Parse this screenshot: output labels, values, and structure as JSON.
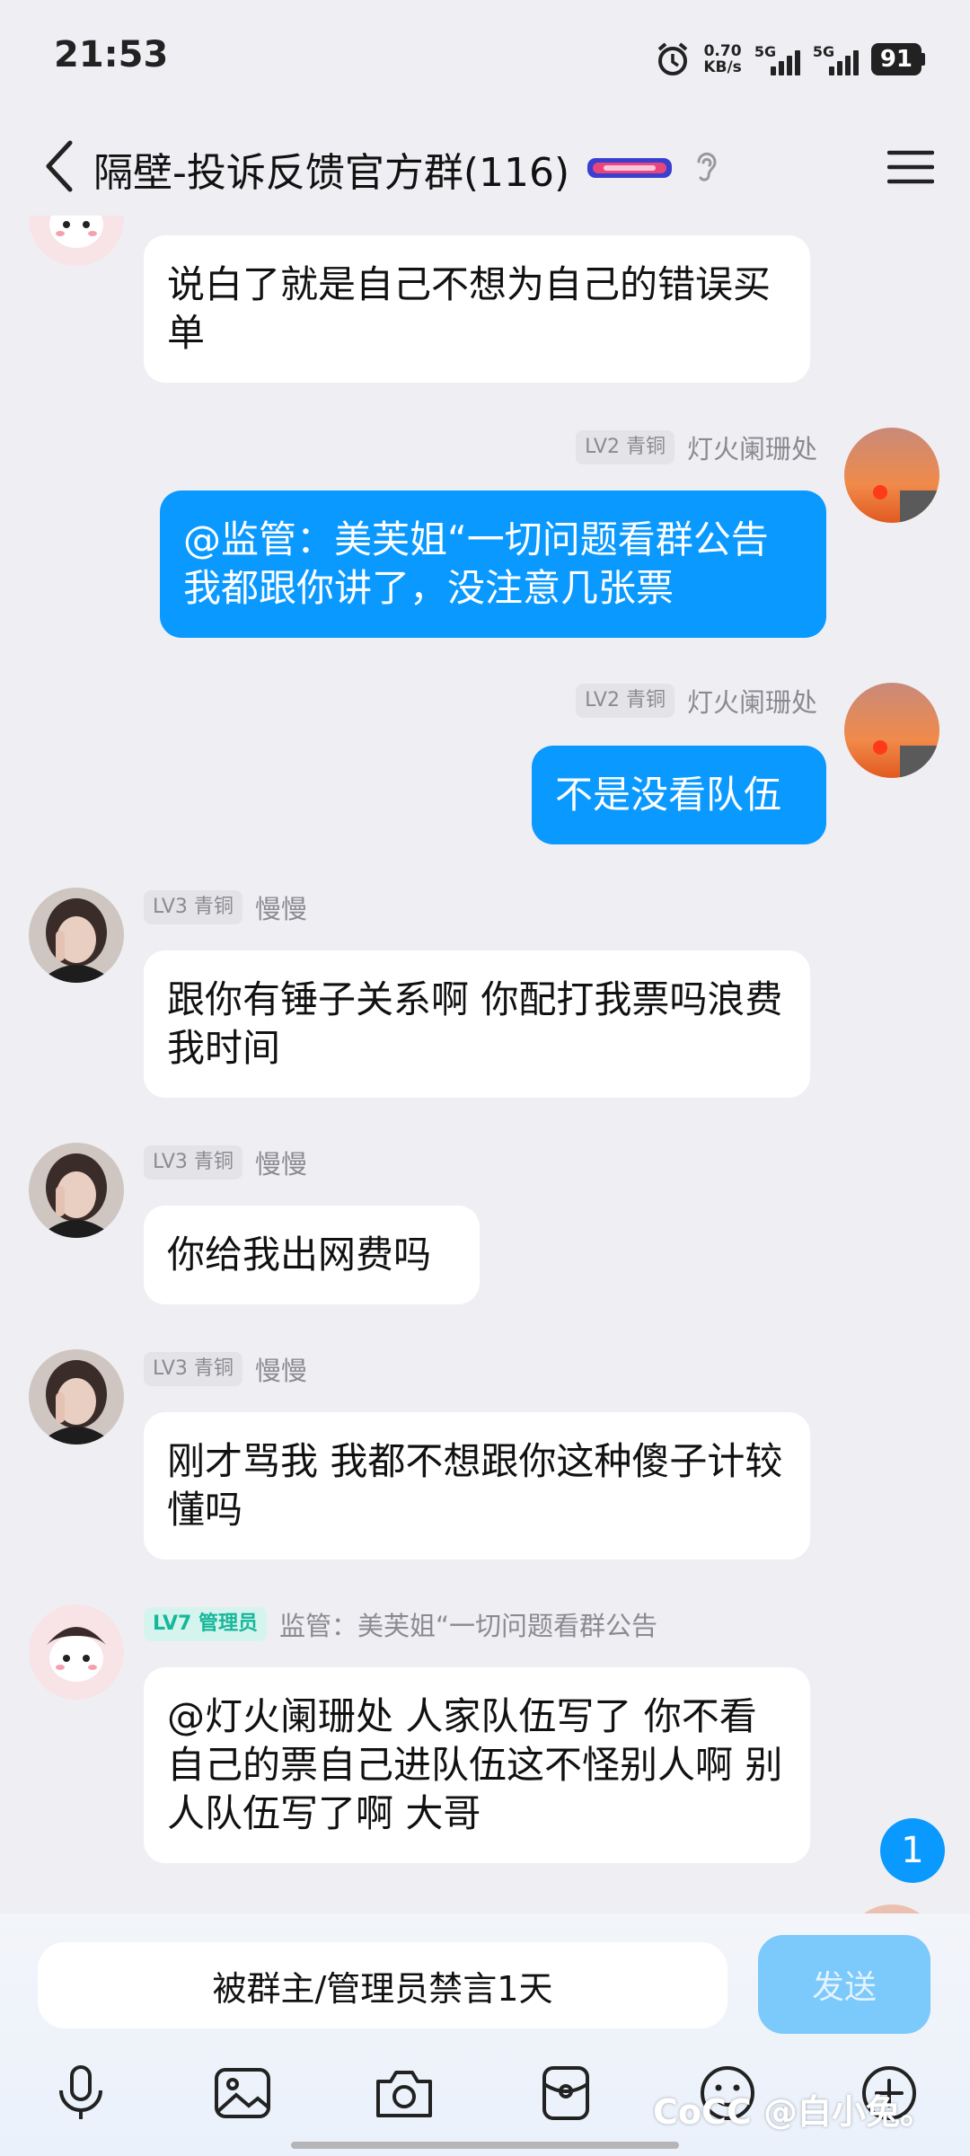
{
  "status_bar": {
    "time": "21:53",
    "net_speed_value": "0.70",
    "net_speed_unit": "KB/s",
    "sim1": "5G",
    "sim2": "5G",
    "battery": "91"
  },
  "header": {
    "title": "隔壁-投诉反馈官方群(116)",
    "badge_icon": "group-badge-icon",
    "ear_icon": "ear-icon",
    "menu_icon": "menu-icon"
  },
  "messages": [
    {
      "bubble": "说白了就是自己不想为自己的错误买单"
    },
    {
      "level": "LV2 青铜",
      "nick": "灯火阑珊处",
      "bubble": "@监管：美芙姐“一切问题看群公告 我都跟你讲了，没注意几张票"
    },
    {
      "level": "LV2 青铜",
      "nick": "灯火阑珊处",
      "bubble": "不是没看队伍"
    },
    {
      "level": "LV3 青铜",
      "nick": "慢慢",
      "bubble": "跟你有锤子关系啊  你配打我票吗浪费我时间"
    },
    {
      "level": "LV3 青铜",
      "nick": "慢慢",
      "bubble": "你给我出网费吗"
    },
    {
      "level": "LV3 青铜",
      "nick": "慢慢",
      "bubble": "刚才骂我 我都不想跟你这种傻子计较懂吗"
    },
    {
      "level": "LV7 管理员",
      "nick": "监管：美芙姐“一切问题看群公告",
      "bubble": "@灯火阑珊处 人家队伍写了  你不看自己的票自己进队伍这不怪别人啊  别人队伍写了啊   大哥"
    }
  ],
  "unread_count": "1",
  "input": {
    "muted_text": "被群主/管理员禁言1天",
    "send_label": "发送"
  },
  "toolbar_icons": [
    "mic-icon",
    "image-icon",
    "camera-icon",
    "red-packet-icon",
    "emoji-icon",
    "plus-icon"
  ],
  "watermark": "CoCC @白小兔。",
  "colors": {
    "background": "#efeff3",
    "outgoing_bubble": "#0a99ff",
    "incoming_bubble": "#ffffff",
    "admin_badge": "#17b79b"
  }
}
